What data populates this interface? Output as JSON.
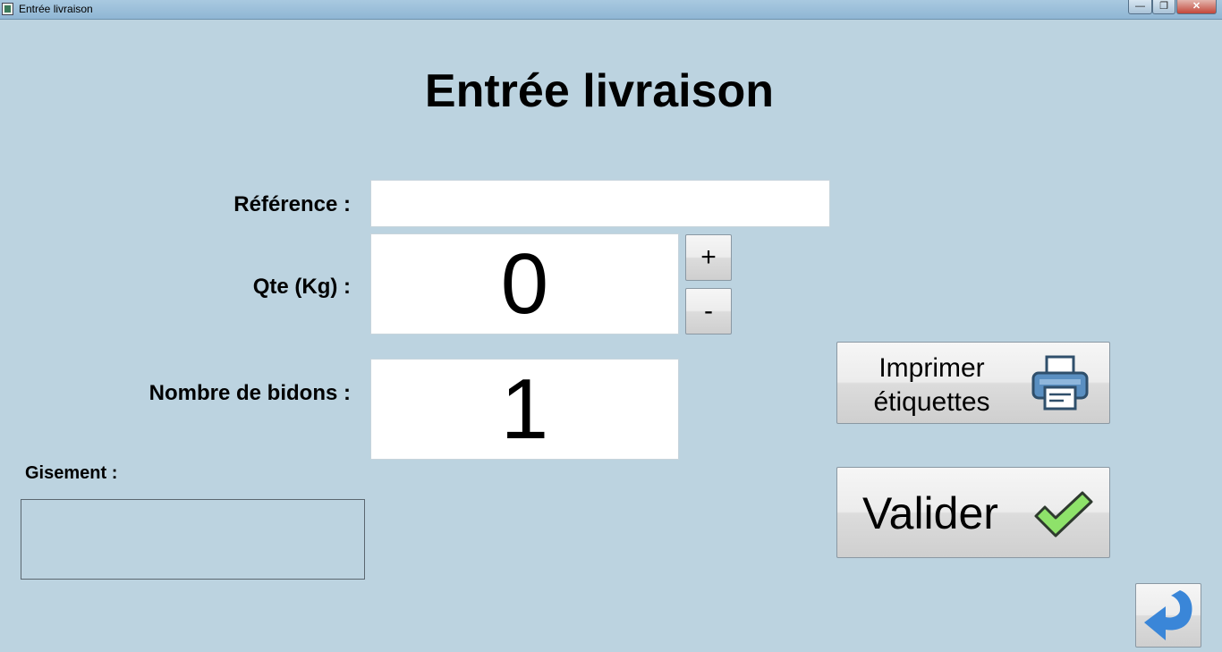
{
  "window": {
    "title": "Entrée livraison",
    "controls": {
      "minimize": "—",
      "maximize": "❐",
      "close": "✕"
    }
  },
  "page": {
    "title": "Entrée livraison"
  },
  "form": {
    "reference": {
      "label": "Référence :",
      "value": ""
    },
    "quantity": {
      "label": "Qte (Kg) :",
      "value": "0",
      "increment_label": "+",
      "decrement_label": "-"
    },
    "containers": {
      "label": "Nombre de bidons :",
      "value": "1"
    },
    "location": {
      "label": "Gisement :",
      "value": ""
    }
  },
  "actions": {
    "print_labels": {
      "line1": "Imprimer",
      "line2": "étiquettes",
      "icon": "printer-icon"
    },
    "validate": {
      "label": "Valider",
      "icon": "checkmark-icon"
    },
    "back": {
      "icon": "back-arrow-icon"
    }
  },
  "colors": {
    "background": "#bcd3e0",
    "printer_blue": "#5a8fc1",
    "check_green": "#8ee26a",
    "back_arrow_blue": "#3a86d8"
  }
}
